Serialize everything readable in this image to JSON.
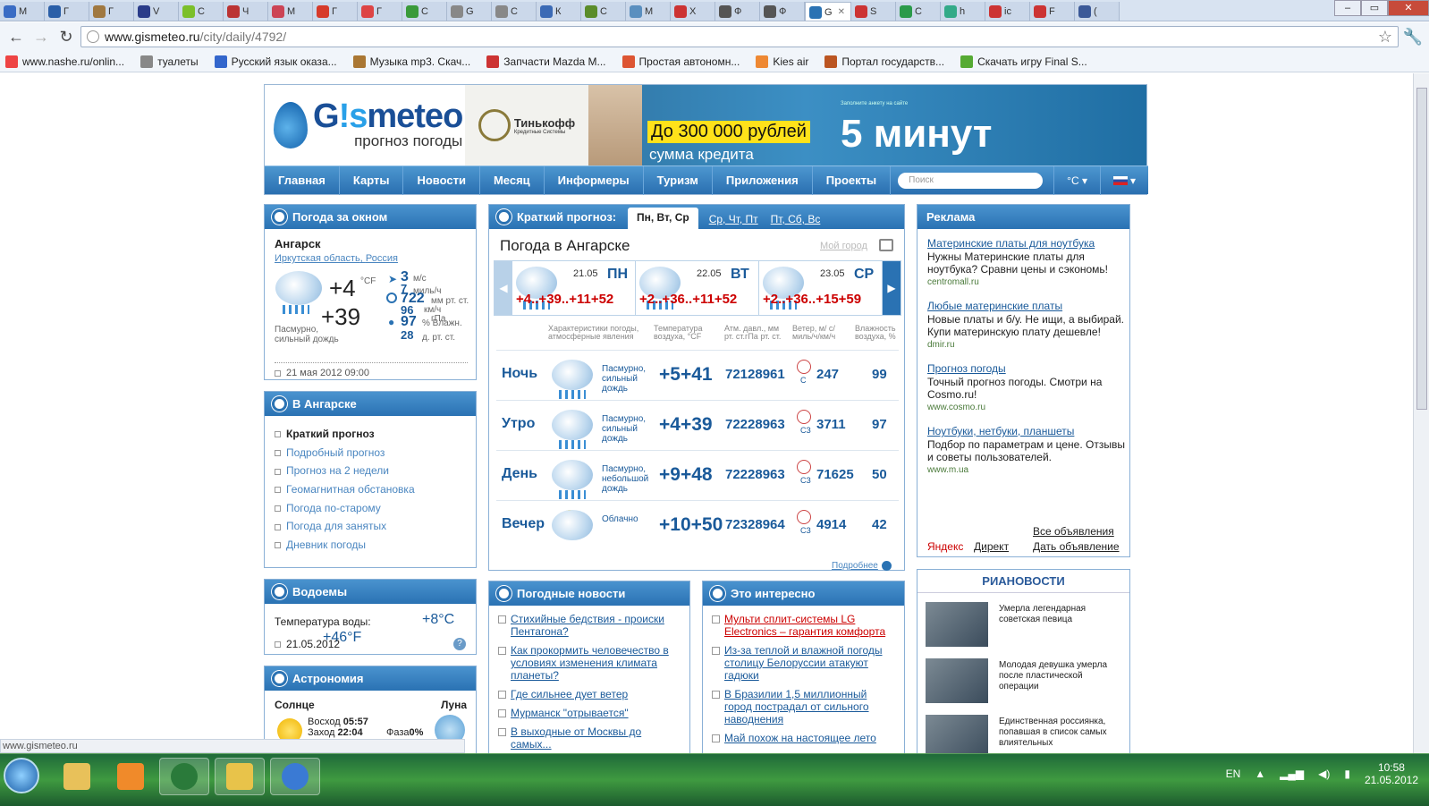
{
  "browser": {
    "tabs": [
      {
        "label": "M",
        "color": "#3a6cc4"
      },
      {
        "label": "Г",
        "color": "#2a5fa8"
      },
      {
        "label": "Г",
        "color": "#a07840"
      },
      {
        "label": "V",
        "color": "#2a3c8a"
      },
      {
        "label": "С",
        "color": "#7bbf2a"
      },
      {
        "label": "Ч",
        "color": "#b33"
      },
      {
        "label": "М",
        "color": "#c45"
      },
      {
        "label": "Г",
        "color": "#d63a2a"
      },
      {
        "label": "Г",
        "color": "#d44"
      },
      {
        "label": "С",
        "color": "#3a9a3a"
      },
      {
        "label": "G",
        "color": "#888"
      },
      {
        "label": "С",
        "color": "#888"
      },
      {
        "label": "К",
        "color": "#3b6ab5"
      },
      {
        "label": "С",
        "color": "#5a8c2a"
      },
      {
        "label": "М",
        "color": "#5a8fbf"
      },
      {
        "label": "Х",
        "color": "#c33"
      },
      {
        "label": "Ф",
        "color": "#555"
      },
      {
        "label": "Ф",
        "color": "#555"
      },
      {
        "label": "G",
        "color": "#2a72b3",
        "active": true
      },
      {
        "label": "S",
        "color": "#c33"
      },
      {
        "label": "С",
        "color": "#2a9a4a"
      },
      {
        "label": "h",
        "color": "#3a8"
      },
      {
        "label": "ic",
        "color": "#c33"
      },
      {
        "label": "F",
        "color": "#c33"
      },
      {
        "label": "(",
        "color": "#3b5998"
      }
    ],
    "address": "www.gismeteo.ru",
    "address_path": "/city/daily/4792/",
    "bookmarks": [
      {
        "label": "www.nashe.ru/onlin...",
        "color": "#e44"
      },
      {
        "label": "туалеты",
        "color": "#888"
      },
      {
        "label": "Русский язык оказа...",
        "color": "#36c"
      },
      {
        "label": "Музыка mp3. Скач...",
        "color": "#a73"
      },
      {
        "label": "Запчасти Mazda M...",
        "color": "#c33"
      },
      {
        "label": "Простая автономн...",
        "color": "#d53"
      },
      {
        "label": "Kies air",
        "color": "#e83"
      },
      {
        "label": "Портал государств...",
        "color": "#b52"
      },
      {
        "label": "Скачать игру Final S...",
        "color": "#5a3"
      }
    ],
    "status": "www.gismeteo.ru"
  },
  "header": {
    "logo_name_a": "G",
    "logo_name_b": "!s",
    "logo_name_c": "meteo",
    "logo_sub": "прогноз погоды",
    "banner_brand": "Тинькофф",
    "banner_brand_sub": "Кредитные Системы",
    "banner_small": "Заполните анкету на сайте",
    "banner_amount": "До 300 000 рублей",
    "banner_big": "5 минут",
    "banner_sub": "сумма кредита"
  },
  "nav": {
    "items": [
      "Главная",
      "Карты",
      "Новости",
      "Месяц",
      "Информеры",
      "Туризм",
      "Приложения",
      "Проекты"
    ],
    "search_placeholder": "Поиск",
    "unit": "°C ▾",
    "flag": "▾"
  },
  "now": {
    "title": "Погода за окном",
    "city": "Ангарск",
    "region_a": "Иркутская область",
    "region_b": "Россия",
    "temp": "+4",
    "temp_units": "°CF",
    "temp_f": "+39",
    "desc": "Пасмурно, сильный дождь",
    "wind": "3",
    "wind_u": "м/с",
    "wind2": "7",
    "wind2_u": "миль/ч",
    "press": "722",
    "press_u": "мм рт. ст.",
    "press2": "96",
    "press2_u": "км/ч",
    "press3": "гПа",
    "hum": "97",
    "hum_u": "% Влажн.",
    "hum2": "28",
    "hum2_u": "д. рт. ст.",
    "date": "21 мая 2012 09:00"
  },
  "city": {
    "title": "В Ангарске",
    "items": [
      "Краткий прогноз",
      "Подробный прогноз",
      "Прогноз на 2 недели",
      "Геомагнитная обстановка",
      "Погода по-старому",
      "Погода для занятых",
      "Дневник погоды"
    ]
  },
  "water": {
    "title": "Водоемы",
    "label": "Температура воды:",
    "temp_c": "+8°C",
    "temp_f": "+46°F",
    "date": "21.05.2012",
    "help": "?"
  },
  "astro": {
    "title": "Астрономия",
    "sun": "Солнце",
    "moon": "Луна",
    "rise_l": "Восход",
    "rise": "05:57",
    "set_l": "Заход",
    "set": "22:04",
    "phase_l": "Фаза",
    "phase": "0%"
  },
  "forecast": {
    "title": "Краткий прогноз:",
    "tab_active": "Пн, Вт, Ср",
    "tab2": "Ср, Чт, Пт",
    "tab3": "Пт, Сб, Вс",
    "city_title": "Погода в Ангарске",
    "my_city": "Мой город",
    "days": [
      {
        "date": "21.05",
        "wd": "ПН",
        "temps": "+4..+39..+11+52"
      },
      {
        "date": "22.05",
        "wd": "ВТ",
        "temps": "+2..+36..+11+52"
      },
      {
        "date": "23.05",
        "wd": "СР",
        "temps": "+2..+36..+15+59"
      }
    ],
    "headers": {
      "h1": "Характеристики погоды, атмосферные явления",
      "h2": "Температура воздуха, °CF",
      "h3": "Атм. давл., мм рт. ст.гПа рт. ст.",
      "h4": "Ветер, м/ с/миль/ч/км/ч",
      "h5": "Влажность воздуха, %"
    },
    "rows": [
      {
        "period": "Ночь",
        "desc": "Пасмурно, сильный дождь",
        "temp": "+5+41",
        "press": "72128961",
        "wdir": "С",
        "wind": "247",
        "hum": "99"
      },
      {
        "period": "Утро",
        "desc": "Пасмурно, сильный дождь",
        "temp": "+4+39",
        "press": "72228963",
        "wdir": "СЗ",
        "wind": "3711",
        "hum": "97"
      },
      {
        "period": "День",
        "desc": "Пасмурно, небольшой дождь",
        "temp": "+9+48",
        "press": "72228963",
        "wdir": "СЗ",
        "wind": "71625",
        "hum": "50"
      },
      {
        "period": "Вечер",
        "desc": "Облачно",
        "temp": "+10+50",
        "press": "72328964",
        "wdir": "СЗ",
        "wind": "4914",
        "hum": "42"
      }
    ],
    "more": "Подробнее"
  },
  "ads": {
    "title": "Реклама",
    "items": [
      {
        "title": "Материнские платы для ноутбука",
        "body": "Нужны Материнские платы для ноутбука? Сравни цены и сэкономь!",
        "url": "centromall.ru"
      },
      {
        "title": "Любые материнские платы",
        "body": "Новые платы и б/у. Не ищи, а выбирай. Купи материнскую плату дешевле!",
        "url": "dmir.ru"
      },
      {
        "title": "Прогноз погоды",
        "body": "Точный прогноз погоды. Смотри на Cosmo.ru!",
        "url": "www.cosmo.ru"
      },
      {
        "title": "Ноутбуки, нетбуки, планшеты",
        "body": "Подбор по параметрам и цене. Отзывы и советы пользователей.",
        "url": "www.m.ua"
      }
    ],
    "yandex": "Яндекс",
    "direct": "Директ",
    "all": "Все объявления",
    "give": "Дать объявление"
  },
  "ria": {
    "logo": "РИАНОВОСТИ",
    "items": [
      "Умерла легендарная советская певица",
      "Молодая девушка умерла после пластической операции",
      "Единственная россиянка, попавшая в список самых влиятельных"
    ]
  },
  "wnews": {
    "title": "Погодные новости",
    "items": [
      "Стихийные бедствия - происки Пентагона?",
      "Как прокормить человечество в условиях изменения климата планеты?",
      "Где сильнее дует ветер",
      "Мурманск \"отрывается\"",
      "В выходные от Москвы до самых..."
    ]
  },
  "interest": {
    "title": "Это интересно",
    "items": [
      "Мульти сплит-системы LG Electronics – гарантия комфорта",
      "Из-за теплой и влажной погоды столицу Белоруссии атакуют гадюки",
      "В Бразилии 1,5 миллионный город пострадал от сильного наводнения",
      "Май похож на настоящее лето"
    ]
  },
  "taskbar": {
    "lang": "EN",
    "time": "10:58",
    "date": "21.05.2012"
  }
}
